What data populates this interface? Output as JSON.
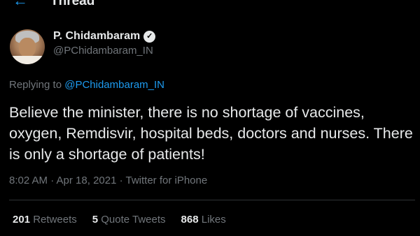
{
  "header": {
    "title": "Thread",
    "back_icon": "back-arrow-icon"
  },
  "author": {
    "display_name": "P. Chidambaram",
    "handle": "@PChidambaram_IN",
    "verified_icon": "verified-badge-icon"
  },
  "reply": {
    "prefix": "Replying to",
    "to_handle": "@PChidambaram_IN"
  },
  "tweet": {
    "text": "Believe the minister, there is no shortage of vaccines, oxygen, Remdisvir, hospital beds, doctors and nurses. There is only a shortage of patients!"
  },
  "meta": {
    "time": "8:02 AM · Apr 18, 2021 · Twitter for iPhone"
  },
  "stats": [
    {
      "count": "201",
      "label": "Retweets"
    },
    {
      "count": "5",
      "label": "Quote Tweets"
    },
    {
      "count": "868",
      "label": "Likes"
    }
  ],
  "colors": {
    "background": "#000000",
    "accent": "#1d9bf0",
    "muted": "#71767b",
    "text": "#e7e9ea"
  }
}
